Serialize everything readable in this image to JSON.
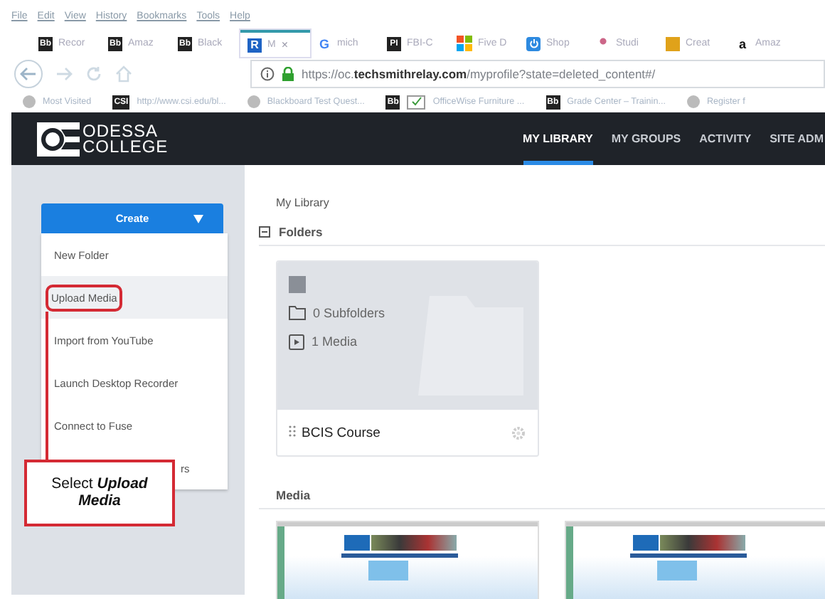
{
  "menu_bar": [
    "File",
    "Edit",
    "View",
    "History",
    "Bookmarks",
    "Tools",
    "Help"
  ],
  "tabs": [
    {
      "icon": "Bb",
      "kind": "dark",
      "label": "Recor",
      "selected": false
    },
    {
      "icon": "Bb",
      "kind": "dark",
      "label": "Amaz",
      "selected": false
    },
    {
      "icon": "Bb",
      "kind": "dark",
      "label": "Black",
      "selected": false
    },
    {
      "icon": "R",
      "kind": "blue",
      "label": "M",
      "close": "×",
      "selected": true
    },
    {
      "icon": "G",
      "kind": "google",
      "label": "mich",
      "selected": false
    },
    {
      "icon": "PI",
      "kind": "dark",
      "label": "FBI-C",
      "selected": false
    },
    {
      "kind": "windows",
      "label": "Five D",
      "selected": false
    },
    {
      "kind": "power",
      "label": "Shop",
      "selected": false
    },
    {
      "kind": "figure",
      "label": "Studi",
      "selected": false
    },
    {
      "kind": "book",
      "label": "Creat",
      "selected": false
    },
    {
      "icon": "a",
      "kind": "amazon",
      "label": "Amaz",
      "selected": false
    }
  ],
  "address_bar": {
    "url": "https://oc.**techsmithrelay.com**/myprofile?state=deleted_content#/"
  },
  "bookmarks": [
    {
      "kind": "star",
      "label": "Most Visited"
    },
    {
      "kind": "dark",
      "icon": "CSI",
      "label": "http://www.csi.edu/bl..."
    },
    {
      "kind": "globe",
      "label": "Blackboard Test Quest..."
    },
    {
      "kind": "dark",
      "icon": "Bb"
    },
    {
      "kind": "check",
      "label": "OfficeWise Furniture ..."
    },
    {
      "kind": "dark",
      "icon": "Bb",
      "label": "Grade Center – Trainin..."
    },
    {
      "kind": "globe",
      "label": "Register f"
    }
  ],
  "app_header": {
    "logo": [
      "ODESSA",
      "COLLEGE"
    ],
    "nav": [
      {
        "label": "MY LIBRARY",
        "selected": true
      },
      {
        "label": "MY GROUPS",
        "selected": false
      },
      {
        "label": "ACTIVITY",
        "selected": false
      },
      {
        "label": "SITE ADM",
        "selected": false
      }
    ]
  },
  "sidebar": {
    "create_button": "Create",
    "menu": [
      {
        "label": "New Folder",
        "selected": false
      },
      {
        "label": "Upload Media",
        "selected": true
      },
      {
        "label": "Import from YouTube",
        "selected": false
      },
      {
        "label": "Launch Desktop Recorder",
        "selected": false
      },
      {
        "label": "Connect to Fuse",
        "selected": false
      },
      {
        "label": "rs",
        "selected": false
      }
    ]
  },
  "callout": {
    "text": "Select **Upload Media**"
  },
  "main": {
    "breadcrumb": "My Library",
    "folders_heading": "Folders",
    "folders": [
      {
        "checked": false,
        "subfolders": "0 Subfolders",
        "media": "1 Media",
        "name": "BCIS Course"
      }
    ],
    "media_heading": "Media",
    "media": [
      {
        "kind": "webpage"
      },
      {
        "kind": "webpage"
      }
    ]
  }
}
